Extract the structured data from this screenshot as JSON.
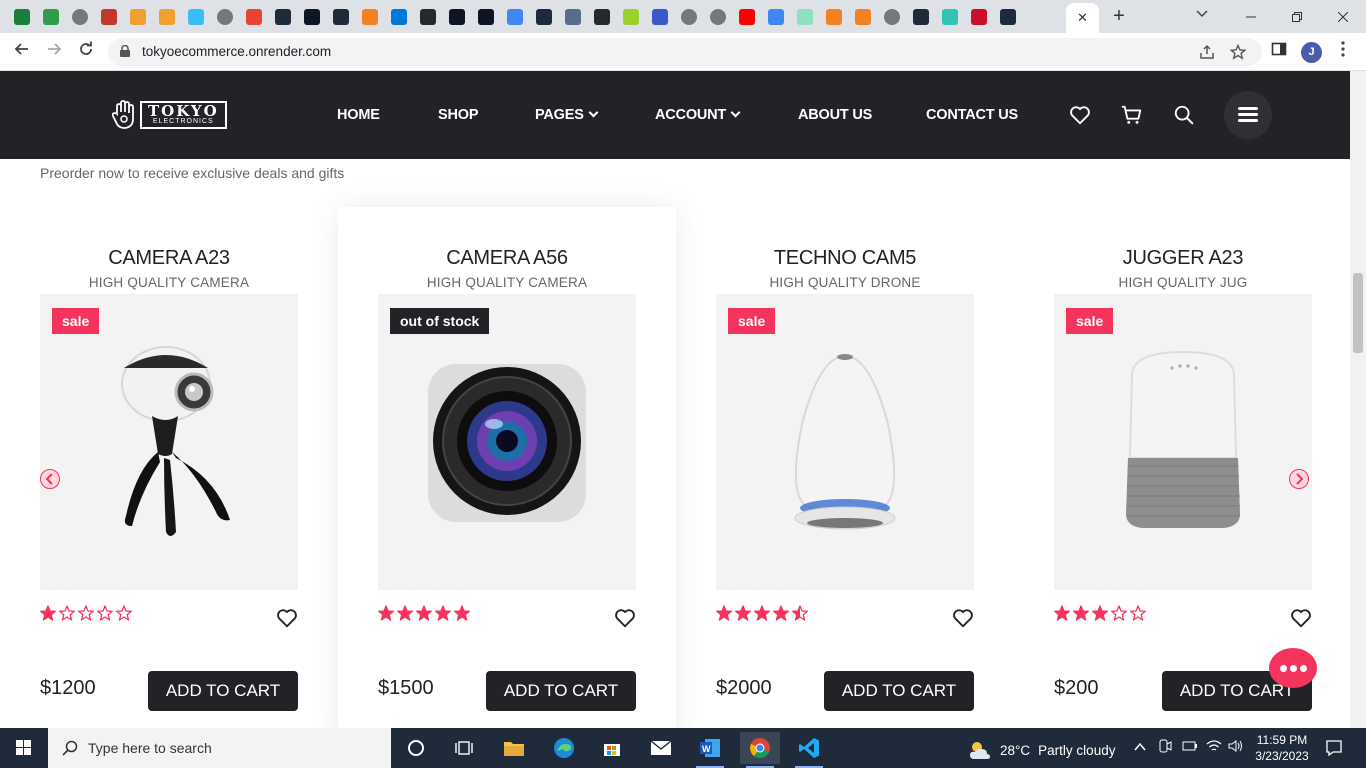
{
  "browser": {
    "url": "tokyoecommerce.onrender.com",
    "profile_initial": "J",
    "tab_close": "✕",
    "new_tab": "+",
    "tab_icons": [
      "upwork",
      "10",
      "globe",
      "profile",
      "stack",
      "stack",
      "tailwind",
      "globe",
      "gmail",
      "react",
      "replit",
      "react",
      "stackoverflow",
      "vscode",
      "github",
      "replit",
      "replit",
      "google",
      "react",
      "cpanel",
      "github",
      "feather",
      "pen",
      "globe",
      "globe",
      "youtube",
      "google",
      "chat",
      "stackoverflow",
      "stackoverflow",
      "globe",
      "react",
      "bolt",
      "netlify",
      "react"
    ],
    "icon_colors": {
      "react": "#61dafb",
      "github": "#24292e",
      "youtube": "#ff0000",
      "vscode": "#0078d7",
      "stack": "#f48024"
    }
  },
  "header": {
    "logo_main": "TOKYO",
    "logo_sub": "ELECTRONICS",
    "menu": [
      {
        "label": "HOME",
        "dropdown": false
      },
      {
        "label": "SHOP",
        "dropdown": false
      },
      {
        "label": "PAGES",
        "dropdown": true
      },
      {
        "label": "ACCOUNT",
        "dropdown": true
      },
      {
        "label": "ABOUT US",
        "dropdown": false
      },
      {
        "label": "CONTACT US",
        "dropdown": false
      }
    ],
    "icons": [
      "heart-icon",
      "cart-icon",
      "search-icon",
      "hamburger-icon"
    ]
  },
  "section": {
    "subtitle": "Preorder now to receive exclusive deals and gifts"
  },
  "products": [
    {
      "name": "CAMERA A23",
      "subtitle": "HIGH QUALITY CAMERA",
      "badge": "sale",
      "badge_type": "sale",
      "rating": 1,
      "price": "$1200",
      "button": "ADD TO CART",
      "image": "360-camera"
    },
    {
      "name": "CAMERA A56",
      "subtitle": "HIGH QUALITY CAMERA",
      "badge": "out of stock",
      "badge_type": "oos",
      "rating": 5,
      "price": "$1500",
      "button": "ADD TO CART",
      "image": "camera-lens"
    },
    {
      "name": "TECHNO CAM5",
      "subtitle": "HIGH QUALITY DRONE",
      "badge": "sale",
      "badge_type": "sale",
      "rating": 4.5,
      "price": "$2000",
      "button": "ADD TO CART",
      "image": "egg-speaker"
    },
    {
      "name": "JUGGER A23",
      "subtitle": "HIGH QUALITY JUG",
      "badge": "sale",
      "badge_type": "sale",
      "rating": 3,
      "price": "$200",
      "button": "ADD TO CART",
      "image": "smart-speaker"
    }
  ],
  "colors": {
    "accent": "#f5345d",
    "dark": "#222326"
  },
  "taskbar": {
    "search_placeholder": "Type here to search",
    "weather_temp": "28°C",
    "weather_desc": "Partly cloudy",
    "time": "11:59 PM",
    "date": "3/23/2023"
  }
}
